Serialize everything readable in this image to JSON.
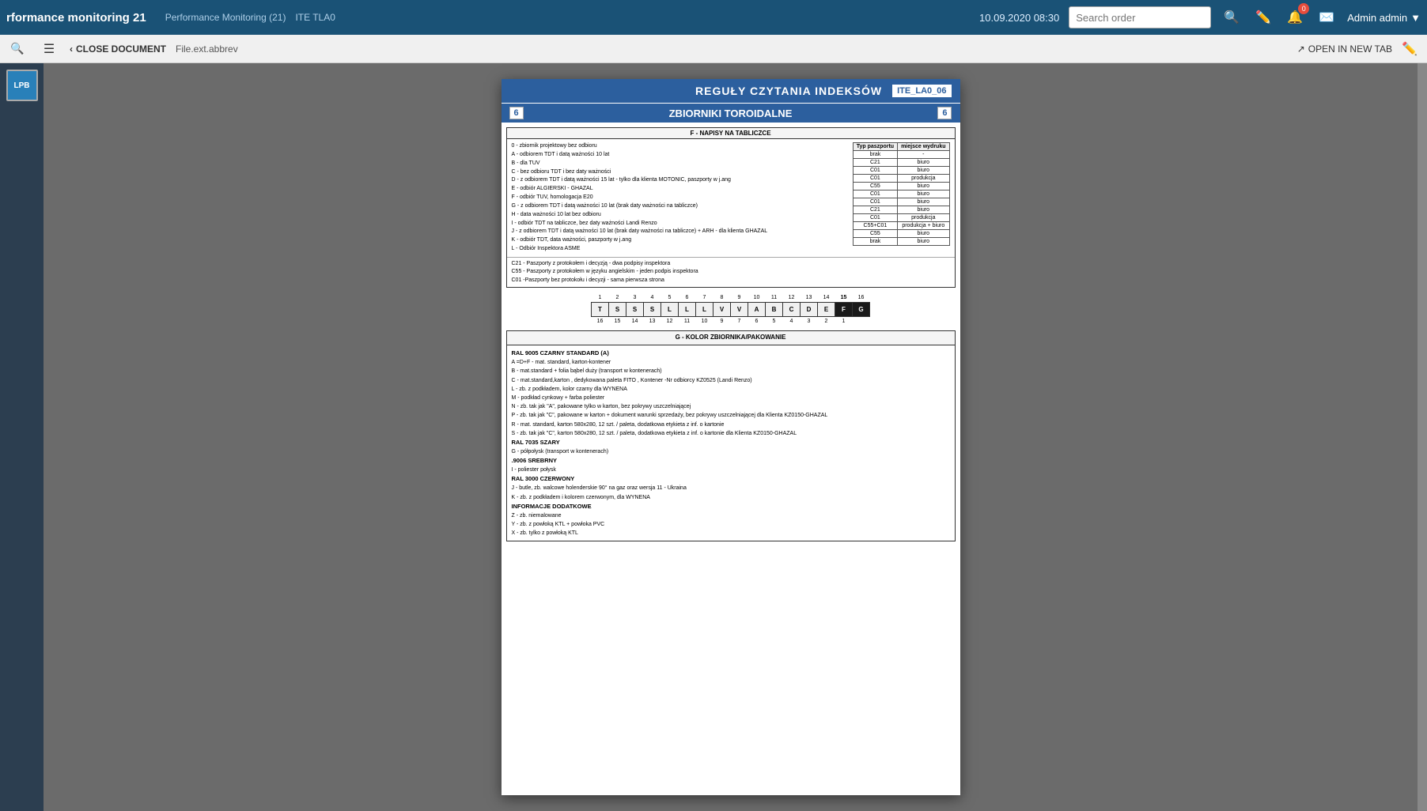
{
  "topbar": {
    "title": "rformance monitoring 21",
    "breadcrumb1": "Performance Monitoring (21)",
    "breadcrumb2": "ITE TLA0",
    "datetime": "10.09.2020 08:30",
    "search_placeholder": "Search order",
    "admin_label": "Admin admin",
    "notif_count": "0"
  },
  "secondbar": {
    "close_label": "CLOSE DOCUMENT",
    "doc_name": "File.ext.abbrev",
    "open_new_tab": "OPEN IN NEW TAB"
  },
  "sidebar": {
    "lpb_label": "LPB"
  },
  "document": {
    "header_title": "REGUŁY CZYTANIA INDEKSÓW",
    "header_code": "ITE_LA0_06",
    "subheader_num_left": "6",
    "subheader_title": "ZBIORNIKI TOROIDALNE",
    "subheader_num_right": "6",
    "section_f_header": "F - NAPISY NA TABLICZCE",
    "passport_type_col": "Typ paszportu",
    "print_place_col": "miejsce wydruku",
    "table_rows": [
      {
        "type": "brak",
        "place": "-"
      },
      {
        "type": "C21",
        "place": "biuro"
      },
      {
        "type": "C01",
        "place": "biuro"
      },
      {
        "type": "C01",
        "place": "produkcja"
      },
      {
        "type": "C55",
        "place": "biuro"
      },
      {
        "type": "C01",
        "place": "biuro"
      },
      {
        "type": "C01",
        "place": "biuro"
      },
      {
        "type": "C21",
        "place": "biuro"
      },
      {
        "type": "C01",
        "place": "produkcja"
      },
      {
        "type": "C55+C01",
        "place": "produkcja + biuro"
      },
      {
        "type": "C55",
        "place": "biuro"
      },
      {
        "type": "brak",
        "place": "biuro"
      }
    ],
    "list_items": [
      "0 - zbiornik projektowy bez odbioru",
      "A - odbiorem TDT i datą ważności 10 lat",
      "B - dla TUV",
      "C - bez odbioru TDT i bez daty ważności",
      "D - z odbiorem TDT i datą ważności 15 lat - tylko dla klienta MOTONIC, paszporty w j.ang",
      "E - odbiór ALGIERSKI - GHAZAL",
      "F - odbiór TUV, homologacja E20",
      "G - z odbiorem TDT i datą ważności 10 lat (brak daty ważności na tabliczce)",
      "H - data ważności 10 lat bez odbioru",
      "I - odbiór TDT na tabliczce, bez daty ważności Landi Renzo",
      "J - z odbiorem TDT i datą ważności 10 lat (brak daty ważności na tabliczce) + ARH - dla klienta GHAZAL",
      "K - odbiór TDT, data ważności, paszporty w j.ang",
      "L - Odbiór Inspektora ASME"
    ],
    "footnotes": [
      "C21 - Paszporty z protokołem i decyzją - dwa podpisy inspektora",
      "C55 - Paszporty z protokołem w języku angielskim - jeden podpis inspektora",
      "C01 - Paszporty bez protokołu i decyzji - sama pierwsza strona"
    ],
    "index_numbers_top": [
      "1",
      "2",
      "3",
      "4",
      "5",
      "6",
      "7",
      "8",
      "9",
      "10",
      "11",
      "12",
      "13",
      "14",
      "15",
      "16"
    ],
    "index_values": [
      "T",
      "S",
      "S",
      "S",
      "L",
      "L",
      "L",
      "V",
      "V",
      "A",
      "B",
      "C",
      "D",
      "E",
      "F",
      "G"
    ],
    "index_numbers_bottom": [
      "16",
      "15",
      "14",
      "13",
      "12",
      "11",
      "10",
      "9",
      "7",
      "6",
      "5",
      "4",
      "3",
      "2",
      "1"
    ],
    "highlighted_indices": [
      15,
      16
    ],
    "section_g_header": "G - KOLOR ZBIORNIKA/PAKOWANIE",
    "color_section_items": [
      {
        "bold": true,
        "text": "RAL 9005 CZARNY STANDARD (A)"
      },
      {
        "bold": false,
        "text": "A =D+F - mat. standard, karton-kontener"
      },
      {
        "bold": false,
        "text": "B - mat.standard + folia bąbel duży (transport w kontenerach)"
      },
      {
        "bold": false,
        "text": "C - mat.standard,karton , dedykowana paleta FITO , Kontener -Nr odbiorcy KZ0525 (Landi Renzo)"
      },
      {
        "bold": false,
        "text": "L - zb. z podkładem, kolor czarny dla WYNENA"
      },
      {
        "bold": false,
        "text": "M - podkład cynkowy + farba poliester"
      },
      {
        "bold": false,
        "text": "N - zb. tak jak \"A\", pakowane tylko w karton, bez pokrywy uszczelniającej"
      },
      {
        "bold": false,
        "text": "P - zb. tak jak \"C\", pakowane w karton + dokument warunki sprzedaży, bez pokrywy uszczelniającej dla Klienta KZ0150-GHAZAL"
      },
      {
        "bold": false,
        "text": "R - mat. standard, karton 580x280, 12 szt. / paleta, dodatkowa etykieta z inf. o kartonie"
      },
      {
        "bold": false,
        "text": "S - zb. tak jak \"C\", karton 580x280, 12 szt. / paleta, dodatkowa etykieta z inf. o kartonie dla Klienta KZ0150-GHAZAL"
      },
      {
        "bold": true,
        "text": "RAL 7035 SZARY"
      },
      {
        "bold": false,
        "text": "G - półpołysk (transport w kontenerach)"
      },
      {
        "bold": true,
        "text": ".9006 SREBRNY"
      },
      {
        "bold": false,
        "text": "I - poliester połysk"
      },
      {
        "bold": true,
        "text": "RAL 3000 CZERWONY"
      },
      {
        "bold": false,
        "text": "J - butle, zb. walcowe holenderskie 90° na gaz oraz wersja 11 - Ukraina"
      },
      {
        "bold": false,
        "text": "K - zb. z podkładem i kolorem czerwonym, dla WYNENA"
      },
      {
        "bold": true,
        "text": "INFORMACJE DODATKOWE"
      },
      {
        "bold": false,
        "text": "Z - zb. niemalowane"
      },
      {
        "bold": false,
        "text": "Y - zb. z powłoką KTL + powłoka PVC"
      },
      {
        "bold": false,
        "text": "X - zb. tylko z powłoką KTL"
      }
    ]
  }
}
